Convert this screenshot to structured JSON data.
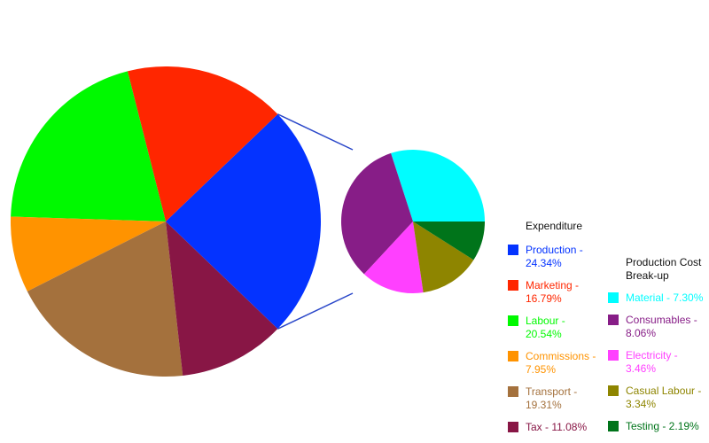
{
  "chart_data": [
    {
      "type": "pie",
      "title": "Expenditure",
      "start_angle_note": "exploded slice Production centered at right",
      "slices": [
        {
          "label": "Production",
          "value": 24.34,
          "color": "#0433FF",
          "legend": "Production - 24.34%"
        },
        {
          "label": "Marketing",
          "value": 16.79,
          "color": "#FF2600",
          "legend": "Marketing - 16.79%"
        },
        {
          "label": "Labour",
          "value": 20.54,
          "color": "#00F900",
          "legend": "Labour - 20.54%"
        },
        {
          "label": "Commissions",
          "value": 7.95,
          "color": "#FF9300",
          "legend": "Commissions - 7.95%"
        },
        {
          "label": "Transport",
          "value": 19.31,
          "color": "#A4713D",
          "legend": "Transport - 19.31%"
        },
        {
          "label": "Tax",
          "value": 11.08,
          "color": "#881645",
          "legend": "Tax - 11.08%"
        }
      ]
    },
    {
      "type": "pie",
      "title": "Production Cost Break-up",
      "parent_slice": "Production",
      "slices": [
        {
          "label": "Material",
          "value": 7.3,
          "color": "#00FDFF",
          "legend": "Material - 7.30%"
        },
        {
          "label": "Consumables",
          "value": 8.06,
          "color": "#871D87",
          "legend": "Consumables - 8.06%"
        },
        {
          "label": "Electricity",
          "value": 3.46,
          "color": "#FF40FF",
          "legend": "Electricity - 3.46%"
        },
        {
          "label": "Casual Labour",
          "value": 3.34,
          "color": "#8E8500",
          "legend": "Casual Labour - 3.34%"
        },
        {
          "label": "Testing",
          "value": 2.19,
          "color": "#00741A",
          "legend": "Testing - 2.19%"
        }
      ]
    }
  ],
  "connector_color": "#2A47C9"
}
